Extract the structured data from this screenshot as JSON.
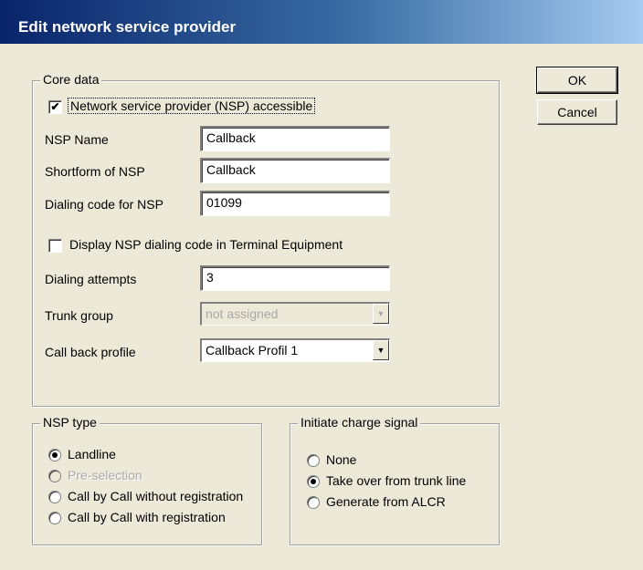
{
  "window": {
    "title": "Edit network service provider"
  },
  "buttons": {
    "ok": "OK",
    "cancel": "Cancel"
  },
  "core_data": {
    "legend": "Core data",
    "accessible": {
      "label": "Network service provider (NSP) accessible",
      "checked": true
    },
    "nsp_name": {
      "label": "NSP Name",
      "value": "Callback"
    },
    "shortform": {
      "label": "Shortform of NSP",
      "value": "Callback"
    },
    "dialing_code": {
      "label": "Dialing code for NSP",
      "value": "01099"
    },
    "display_code": {
      "label": "Display NSP dialing code in Terminal Equipment",
      "checked": false
    },
    "dialing_attempts": {
      "label": "Dialing attempts",
      "value": "3"
    },
    "trunk_group": {
      "label": "Trunk group",
      "value": "not assigned",
      "enabled": false
    },
    "call_back_profile": {
      "label": "Call back profile",
      "value": "Callback Profil 1"
    }
  },
  "nsp_type": {
    "legend": "NSP type",
    "options": [
      {
        "label": "Landline",
        "selected": true,
        "enabled": true
      },
      {
        "label": "Pre-selection",
        "selected": false,
        "enabled": false
      },
      {
        "label": "Call by Call without registration",
        "selected": false,
        "enabled": true
      },
      {
        "label": "Call by Call with registration",
        "selected": false,
        "enabled": true
      }
    ]
  },
  "charge_signal": {
    "legend": "Initiate charge signal",
    "options": [
      {
        "label": "None",
        "selected": false
      },
      {
        "label": "Take over from trunk line",
        "selected": true
      },
      {
        "label": "Generate from ALCR",
        "selected": false
      }
    ]
  },
  "icons": {
    "checkmark": "✔",
    "dropdown_arrow": "▼"
  }
}
